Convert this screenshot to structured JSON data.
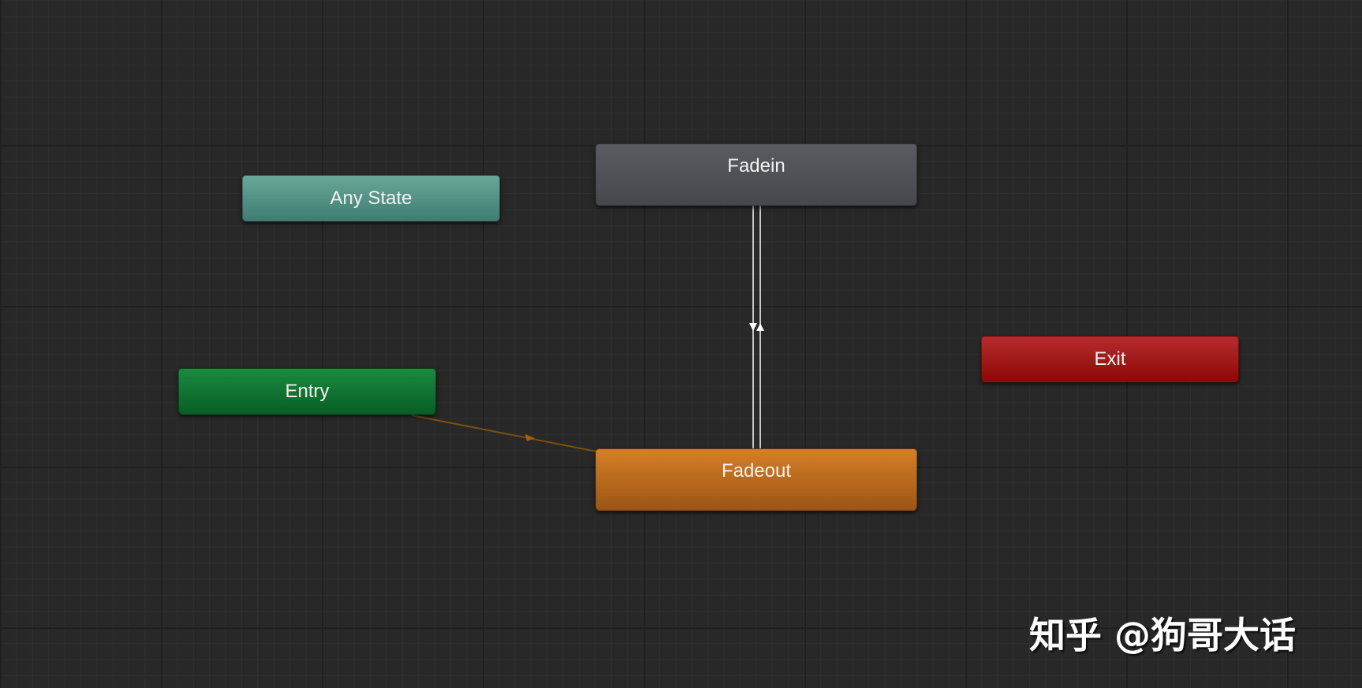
{
  "states": {
    "any_state": "Any State",
    "fadein": "Fadein",
    "entry": "Entry",
    "exit": "Exit",
    "fadeout": "Fadeout"
  },
  "colors": {
    "background": "#282828",
    "any_state": "#4f8f82",
    "fadein": "#505156",
    "entry": "#0a7030",
    "exit": "#a01414",
    "fadeout": "#c06a1e",
    "default_transition": "#8a5a10",
    "transition": "#c8c8c8"
  },
  "transitions": [
    {
      "from": "Entry",
      "to": "Fadeout",
      "type": "default"
    },
    {
      "from": "Fadein",
      "to": "Fadeout",
      "type": "normal"
    },
    {
      "from": "Fadeout",
      "to": "Fadein",
      "type": "normal"
    }
  ],
  "watermark": "知乎 @狗哥大话"
}
